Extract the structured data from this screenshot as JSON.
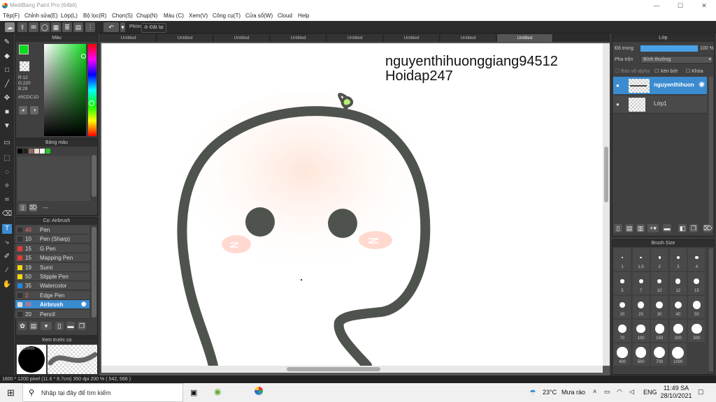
{
  "window": {
    "title": "MediBang Paint Pro (64bit)",
    "min": "—",
    "max": "☐",
    "close": "✕"
  },
  "menu": [
    "Tệp(F)",
    "Chỉnh sửa(E)",
    "Lớp(L)",
    "Bộ lọc(R)",
    "Chọn(S)",
    "Chụp(N)",
    "Màu (C)",
    "Xem(V)",
    "Công cụ(T)",
    "Cửa sổ(W)",
    "Cloud",
    "Help"
  ],
  "toolbar": {
    "keys_label": "Phím",
    "reset_label": "Đặt lại"
  },
  "tabs": [
    "Untitled",
    "Untitled",
    "Untitled",
    "Untitled",
    "Untitled",
    "Untitled",
    "Untitled",
    "Untitled"
  ],
  "color_panel": {
    "title": "Màu",
    "r": "R:12",
    "g": "G:220",
    "b": "B:29",
    "hex": "#0CDC1D",
    "fg_color": "#0CDC1D",
    "bg_color": "#000000"
  },
  "palette_panel": {
    "title": "Bảng màu",
    "swatches": [
      "#000000",
      "#222222",
      "#8a6e66",
      "#f2d7cf",
      "#ffffff",
      "#27c62a"
    ],
    "footer": "---"
  },
  "brush_panel": {
    "title": "Cọ: Airbrush",
    "brushes": [
      {
        "size": "40",
        "name": "Pen",
        "color": "#333333",
        "size_color": "#ff6b6b"
      },
      {
        "size": "10",
        "name": "Pen (Sharp)",
        "color": "#333333",
        "size_color": "#dddddd"
      },
      {
        "size": "15",
        "name": "G Pen",
        "color": "#e53935",
        "size_color": "#dddddd"
      },
      {
        "size": "15",
        "name": "Mapping Pen",
        "color": "#e53935",
        "size_color": "#dddddd"
      },
      {
        "size": "19",
        "name": "Sumi",
        "color": "#f5d90a",
        "size_color": "#dddddd"
      },
      {
        "size": "50",
        "name": "Stipple Pen",
        "color": "#f5d90a",
        "size_color": "#dddddd"
      },
      {
        "size": "35",
        "name": "Watercolor",
        "color": "#1e88e5",
        "size_color": "#dddddd"
      },
      {
        "size": "2",
        "name": "Edge Pen",
        "color": "#333333",
        "size_color": "#ff6b6b"
      },
      {
        "size": "40",
        "name": "Airbrush",
        "color": "#dddddd",
        "size_color": "#ff6b6b"
      },
      {
        "size": "20",
        "name": "Pencil",
        "color": "#333333",
        "size_color": "#dddddd"
      }
    ]
  },
  "preview_panel": {
    "title": "Xem trước cọ",
    "size": "2,50mm"
  },
  "canvas": {
    "text_line1": "nguyenthihuonggiang94512",
    "text_line2": "Hoidap247"
  },
  "layer_panel": {
    "title": "Lớp",
    "opacity_label": "Độ trong",
    "opacity_value": "100 %",
    "opacity": 1.0,
    "blend_label": "Pha trộn",
    "blend_value": "Bình thường",
    "protect_alpha": "Bảo vệ alpha",
    "clipping": "Xén bớt",
    "lock": "Khóa",
    "layers": [
      {
        "name": "nguyenthihuon",
        "selected": true
      },
      {
        "name": "Lớp1",
        "selected": false
      }
    ]
  },
  "brush_size_panel": {
    "title": "Brush Size",
    "sizes": [
      "1",
      "1.5",
      "2",
      "3",
      "4",
      "5",
      "7",
      "10",
      "12",
      "15",
      "20",
      "25",
      "30",
      "40",
      "50",
      "70",
      "100",
      "150",
      "200",
      "300",
      "400",
      "500",
      "700",
      "1000"
    ]
  },
  "status": {
    "size": "1600 * 1200 pixel",
    "size_cm": "(11.6 * 8.7cm)",
    "dpi": "350 dpi",
    "zoom": "200 %",
    "coords": "( 542, 566 )"
  },
  "taskbar": {
    "search_placeholder": "Nhập tại đây để tìm kiếm",
    "weather_temp": "23°C",
    "weather_desc": "Mưa rào",
    "lang": "ENG",
    "time": "11:49 SA",
    "date": "28/10/2021"
  }
}
